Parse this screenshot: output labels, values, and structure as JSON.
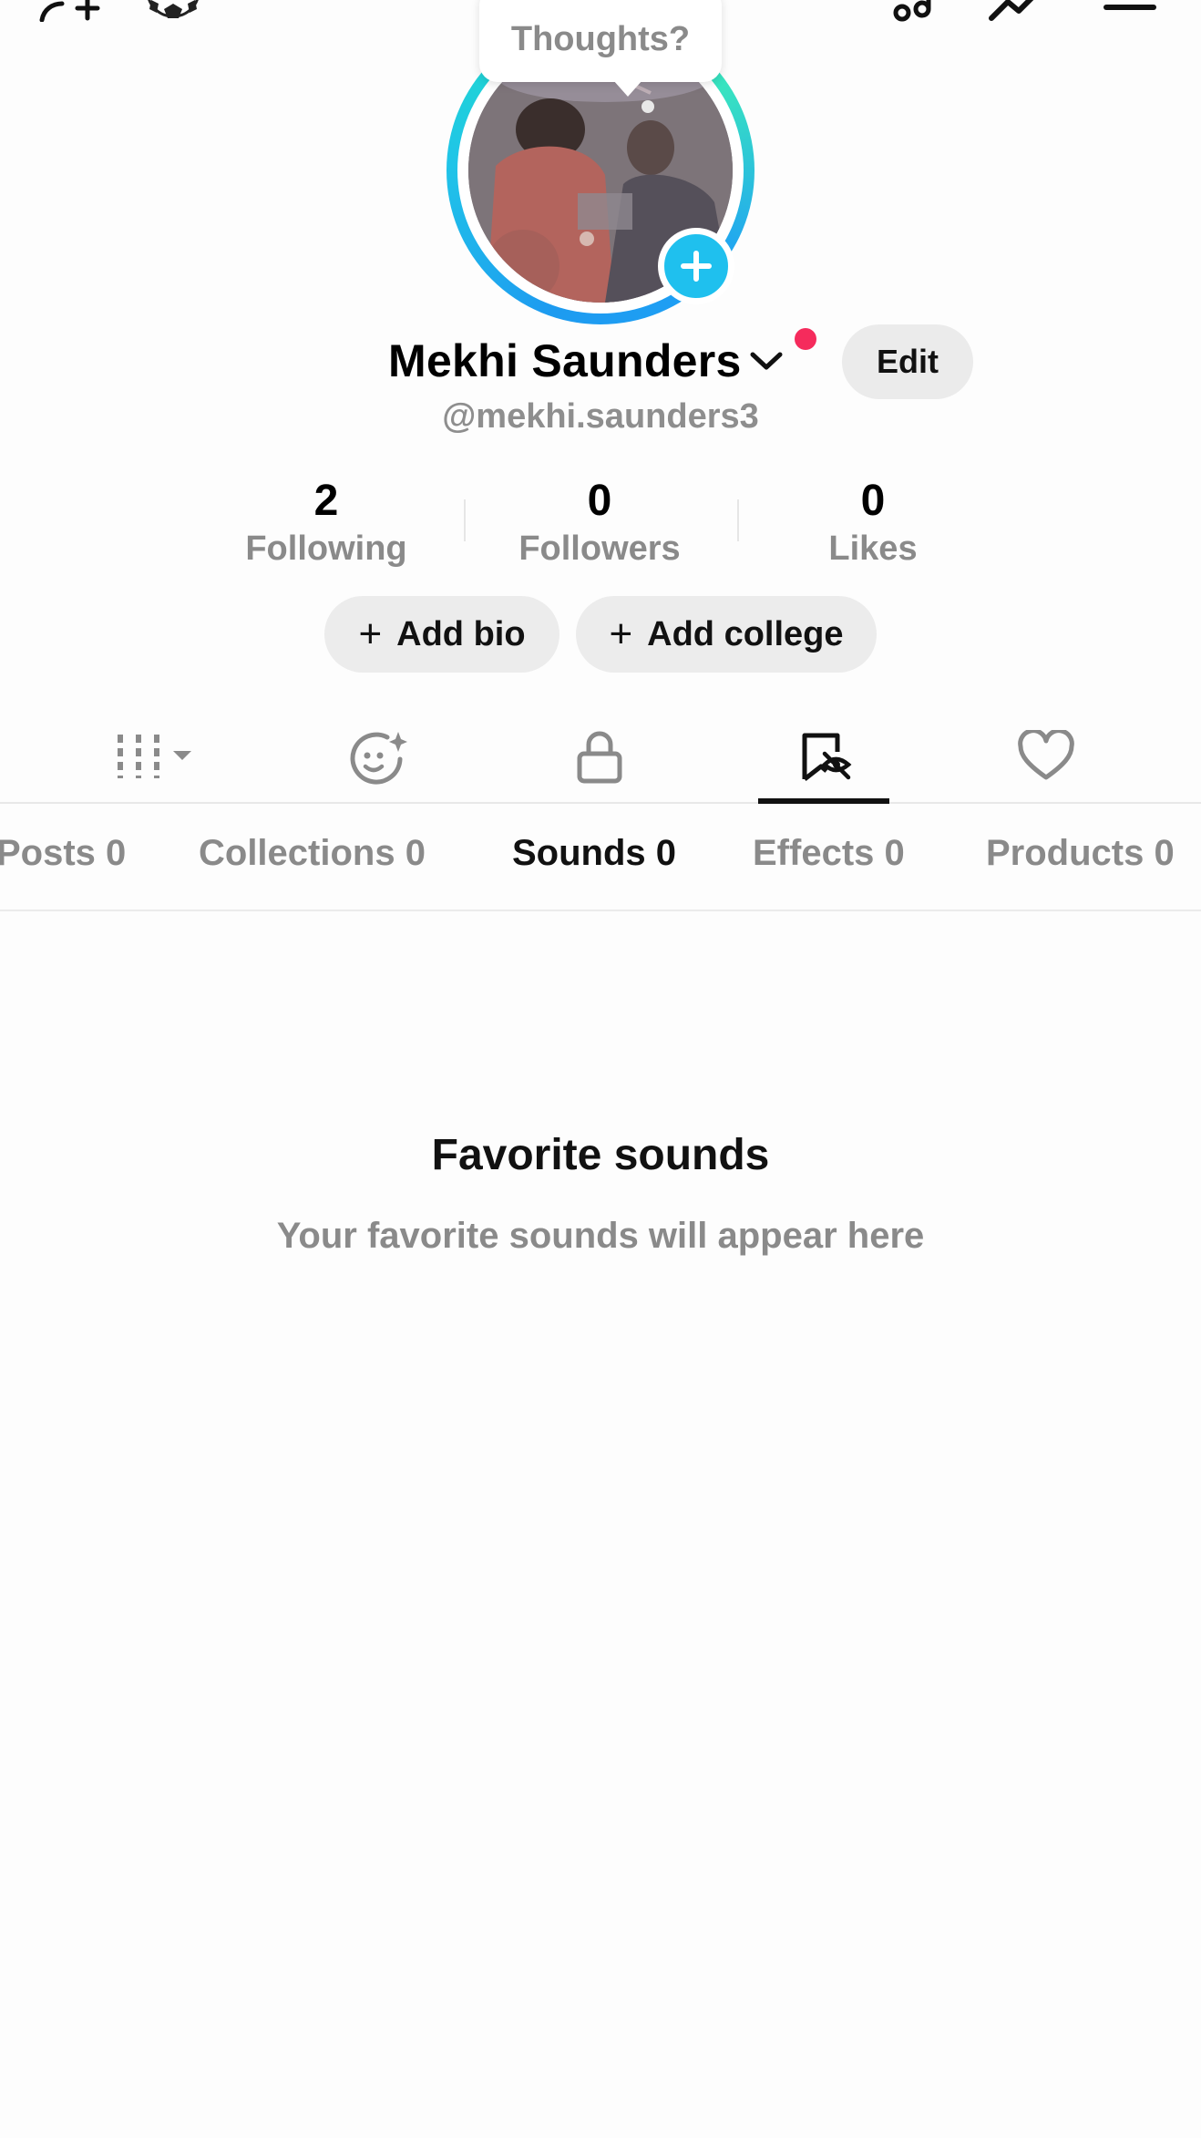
{
  "bubble": {
    "text": "Thoughts?"
  },
  "profile": {
    "display_name": "Mekhi Saunders",
    "username": "@mekhi.saunders3",
    "edit_label": "Edit"
  },
  "stats": [
    {
      "value": "2",
      "label": "Following"
    },
    {
      "value": "0",
      "label": "Followers"
    },
    {
      "value": "0",
      "label": "Likes"
    }
  ],
  "actions": {
    "add_bio": "Add bio",
    "add_college": "Add college"
  },
  "icon_tabs": [
    {
      "icon": "grid-icon",
      "active": false
    },
    {
      "icon": "ai-self-icon",
      "active": false
    },
    {
      "icon": "lock-icon",
      "active": false
    },
    {
      "icon": "favorites-icon",
      "active": true
    },
    {
      "icon": "heart-icon",
      "active": false
    }
  ],
  "text_tabs": [
    {
      "label": "Posts 0",
      "active": false
    },
    {
      "label": "Collections 0",
      "active": false
    },
    {
      "label": "Sounds 0",
      "active": true
    },
    {
      "label": "Effects 0",
      "active": false
    },
    {
      "label": "Products 0",
      "active": false
    }
  ],
  "empty_state": {
    "title": "Favorite sounds",
    "subtitle": "Your favorite sounds will appear here"
  },
  "colors": {
    "accent": "#1fc0ee",
    "notification": "#f52b5c",
    "text_secondary": "#8a8a8a"
  }
}
